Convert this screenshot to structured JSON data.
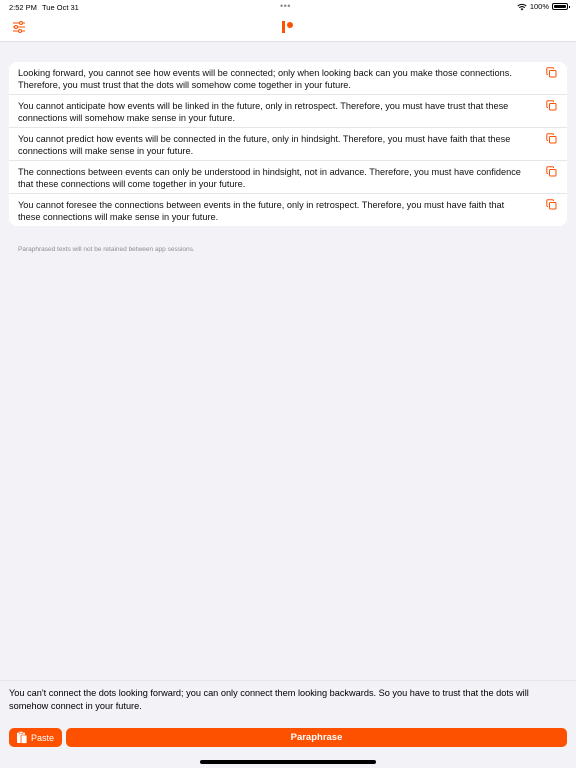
{
  "status_bar": {
    "time": "2:52 PM",
    "date": "Tue Oct 31",
    "battery": "100%"
  },
  "nav": {
    "settings_icon": "sliders-icon",
    "logo_icon": "app-logo"
  },
  "results": [
    "Looking forward, you cannot see how events will be connected; only when looking back can you make those connections. Therefore, you must trust that the dots will somehow come together in your future.",
    "You cannot anticipate how events will be linked in the future, only in retrospect. Therefore, you must have trust that these connections will somehow make sense in your future.",
    "You cannot predict how events will be connected in the future, only in hindsight. Therefore, you must have faith that these connections will make sense in your future.",
    "The connections between events can only be understood in hindsight, not in advance. Therefore, you must have confidence that these connections will come together in your future.",
    "You cannot foresee the connections between events in the future, only in retrospect. Therefore, you must have faith that these connections will make sense in your future."
  ],
  "note": "Paraphrased texts will not be retained between app sessions.",
  "input": {
    "text": "You can't connect the dots looking forward; you can only connect them looking backwards. So you have to trust that the dots will somehow connect in your future."
  },
  "buttons": {
    "paste": "Paste",
    "paraphrase": "Paraphrase"
  },
  "colors": {
    "accent": "#fd5100",
    "background": "#f2f2f7"
  }
}
